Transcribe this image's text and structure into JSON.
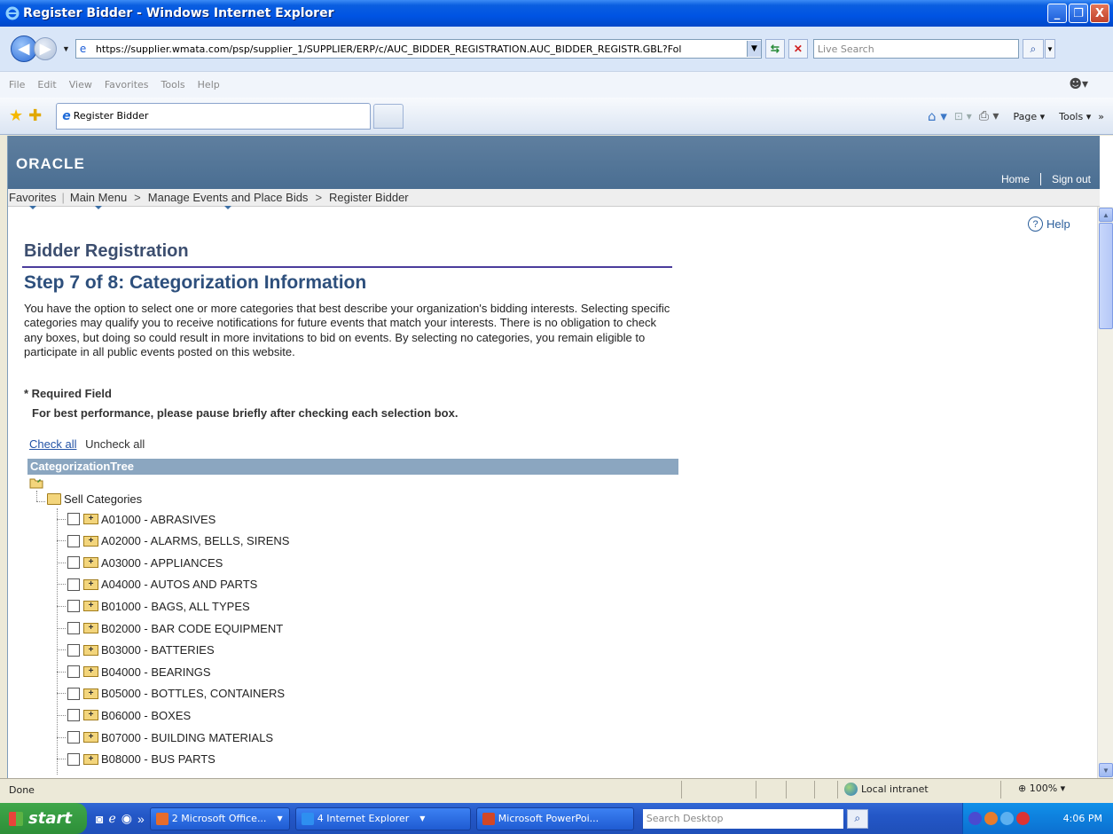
{
  "window": {
    "title": "Register Bidder - Windows Internet Explorer",
    "minimize": "_",
    "restore": "❐",
    "close": "X"
  },
  "address": {
    "url": "https://supplier.wmata.com/psp/supplier_1/SUPPLIER/ERP/c/AUC_BIDDER_REGISTRATION.AUC_BIDDER_REGISTR.GBL?Fol",
    "search_placeholder": "Live Search"
  },
  "menubar": {
    "items": [
      "File",
      "Edit",
      "View",
      "Favorites",
      "Tools",
      "Help"
    ]
  },
  "tabs": {
    "active_tab": "Register Bidder",
    "commands": [
      "Page",
      "Tools"
    ]
  },
  "page": {
    "banner_links": [
      "Home",
      "Sign out"
    ],
    "breadcrumb": [
      "Favorites",
      "Main Menu",
      "Manage Events and Place Bids",
      "Register Bidder"
    ],
    "help_label": "Help",
    "title": "Bidder Registration",
    "step_title": "Step 7 of 8: Categorization Information",
    "description": "You have the option to select one or more categories that best describe your organization's bidding interests. Selecting specific categories may qualify you to receive notifications for future events that match your interests. There is no obligation to check any boxes, but doing so could result in more invitations to bid on events.  By selecting no categories, you remain eligible to participate in all public events posted on this website.",
    "required_note": "* Required Field",
    "performance_note": "For best performance, please pause briefly after checking each selection box.",
    "check_all": "Check all",
    "uncheck_all": "Uncheck all",
    "tree_header": "CategorizationTree",
    "root_label": "Sell Categories",
    "categories": [
      "A01000 - ABRASIVES",
      "A02000 - ALARMS, BELLS, SIRENS",
      "A03000 - APPLIANCES",
      "A04000 - AUTOS AND PARTS",
      "B01000 - BAGS, ALL TYPES",
      "B02000 - BAR CODE EQUIPMENT",
      "B03000 - BATTERIES",
      "B04000 - BEARINGS",
      "B05000 - BOTTLES, CONTAINERS",
      "B06000 - BOXES",
      "B07000 - BUILDING MATERIALS",
      "B08000 - BUS PARTS"
    ]
  },
  "statusbar": {
    "status": "Done",
    "zone": "Local intranet",
    "zoom": "100%"
  },
  "taskbar": {
    "start": "start",
    "tasks": [
      "2 Microsoft Office...",
      "4 Internet Explorer",
      "Microsoft PowerPoi..."
    ],
    "search_placeholder": "Search Desktop",
    "clock": "4:06 PM"
  }
}
